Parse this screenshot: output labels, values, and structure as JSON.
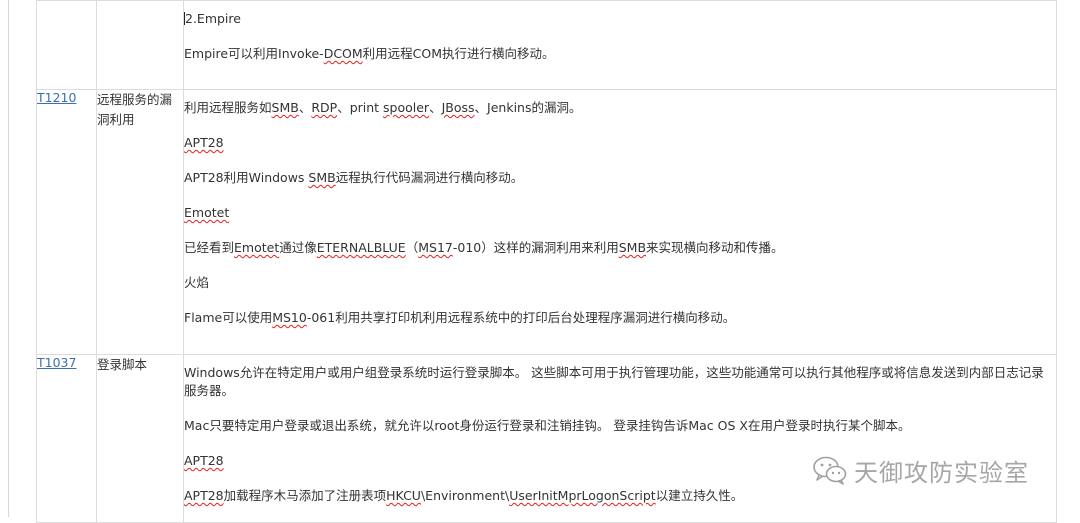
{
  "rows": [
    {
      "id": "",
      "name": "",
      "paragraphs": [
        [
          "2.Empire"
        ],
        [
          "Empire可以利用Invoke-",
          {
            "sq": "DCOM"
          },
          "利用远程COM执行进行横向移动。"
        ]
      ]
    },
    {
      "id": "T1210",
      "name": "远程服务的漏洞利用",
      "paragraphs": [
        [
          "利用远程服务如",
          {
            "sq": "SMB"
          },
          "、",
          {
            "sq": "RDP"
          },
          "、print ",
          {
            "sq": "spooler"
          },
          "、",
          {
            "sq": "JBoss"
          },
          "、Jenkins的漏洞。"
        ],
        [
          {
            "sq": "APT28"
          }
        ],
        [
          "APT28利用Windows ",
          {
            "sq": "SMB"
          },
          "远程执行代码漏洞进行横向移动。"
        ],
        [
          {
            "sq": "Emotet"
          }
        ],
        [
          "已经看到",
          {
            "sq": "Emotet"
          },
          "通过像",
          {
            "sq": "ETERNALBLUE"
          },
          "（",
          {
            "sq": "MS17"
          },
          "-010）这样的漏洞利用来利用",
          {
            "sq": "SMB"
          },
          "来实现横向移动和传播。"
        ],
        [
          "火焰"
        ],
        [
          "Flame可以使用",
          {
            "sq": "MS10"
          },
          "-061利用共享打印机利用远程系统中的打印后台处理程序漏洞进行横向移动。"
        ]
      ]
    },
    {
      "id": "T1037",
      "name": "登录脚本",
      "paragraphs": [
        [
          "Windows允许在特定用户或用户组登录系统时运行登录脚本。 这些脚本可用于执行管理功能，这些功能通常可以执行其他程序或将信息发送到内部日志记录服务器。"
        ],
        [
          "Mac只要特定用户登录或退出系统，就允许以root身份运行登录和注销挂钩。 登录挂钩告诉Mac OS X在用户登录时执行某个脚本。"
        ],
        [
          {
            "sq": "APT28"
          }
        ],
        [
          {
            "sq": "APT28"
          },
          "加载程序木马添加了注册表项",
          {
            "sq": "HKCU"
          },
          "\\Environment\\",
          {
            "sq": "UserInitMprLogonScript"
          },
          "以建立持久性。"
        ]
      ]
    }
  ],
  "watermark": {
    "text": "天御攻防实验室",
    "icon": "wechat-icon"
  },
  "colors": {
    "link": "#3b6fb6",
    "spellcheck": "#e02020",
    "border": "#dcdcdc",
    "text": "#333333"
  }
}
